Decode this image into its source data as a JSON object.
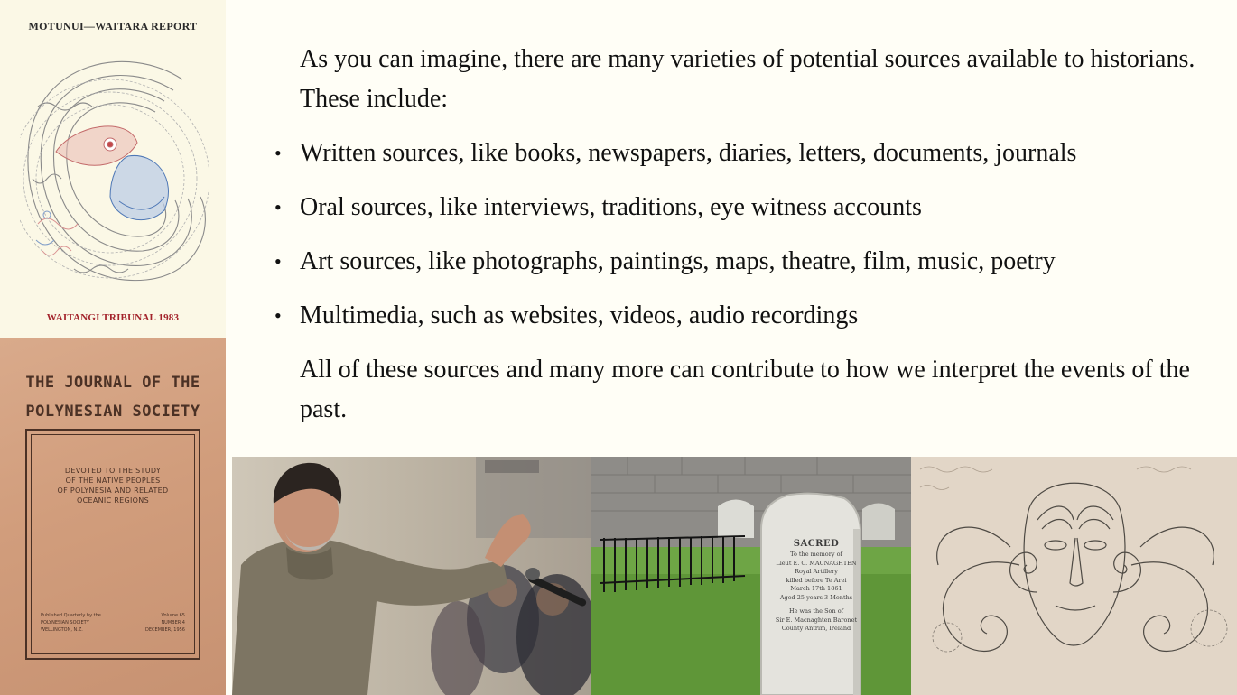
{
  "cover1": {
    "title": "MOTUNUI—WAITARA REPORT",
    "footer": "WAITANGI TRIBUNAL 1983"
  },
  "cover2": {
    "title_line1": "THE JOURNAL OF THE",
    "title_line2": "POLYNESIAN SOCIETY",
    "desc_line1": "DEVOTED TO THE STUDY",
    "desc_line2": "OF THE NATIVE PEOPLES",
    "desc_line3": "OF POLYNESIA AND RELATED",
    "desc_line4": "OCEANIC REGIONS",
    "pub_line1": "Published Quarterly by the",
    "pub_line2": "POLYNESIAN SOCIETY",
    "pub_line3": "WELLINGTON, N.Z.",
    "vol_line1": "Volume 65",
    "vol_line2": "NUMBER 4",
    "vol_line3": "DECEMBER, 1956"
  },
  "content": {
    "intro": "As you can imagine, there are many varieties of potential sources available to historians. These include:",
    "bullet_char": "•",
    "items": [
      "Written sources, like books, newspapers, diaries, letters, documents, journals",
      "Oral sources, like interviews, traditions, eye witness accounts",
      "Art sources, like photographs, paintings, maps, theatre, film, music, poetry",
      "Multimedia, such as websites, videos, audio recordings"
    ],
    "outro": "All of these sources and many more can contribute to how we interpret the events of the past."
  },
  "gravestone": {
    "line1": "SACRED",
    "line2": "To the memory of",
    "line3": "Lieut E. C. MACNAGHTEN",
    "line4": "Royal Artillery",
    "line5": "killed before Te Arei",
    "line6": "March 17th 1861",
    "line7": "Aged 25 years 3 Months",
    "line8": "He was the Son of",
    "line9": "Sir E. Macnaghten Baronet",
    "line10": "County Antrim, Ireland"
  },
  "colors": {
    "background": "#fffef6",
    "cover1_red": "#a3232b",
    "cover2_brown": "#d19d7c"
  }
}
